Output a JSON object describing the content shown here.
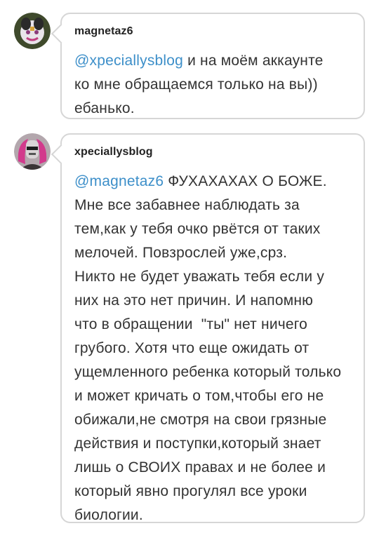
{
  "comments": [
    {
      "username": "magnetaz6",
      "mention": "@xpeciallysblog",
      "first_line_rest": " и на моём аккаунте",
      "lines": [
        "ко мне обращаемся только на вы))",
        "ебанько."
      ]
    },
    {
      "username": "xpeciallysblog",
      "mention": "@magnetaz6",
      "first_line_rest": " ФУХАХАХАХ О БОЖЕ.",
      "lines": [
        "Мне все забавнее наблюдать за",
        "тем,как у тебя очко рвётся от таких",
        "мелочей. Повзрослей уже,срз.",
        "Никто не будет уважать тебя если у",
        "них на это нет причин. И напомню",
        "что в обращении  \"ты\" нет ничего",
        "грубого. Хотя что еще ожидать от",
        "ущемленного ребенка который только",
        "и может кричать о том,чтобы его не",
        "обижали,не смотря на свои грязные",
        "действия и поступки,который знает",
        "лишь о СВОИХ правах и не более и",
        "который явно прогулял все уроки",
        "биологии."
      ]
    }
  ],
  "colors": {
    "mention": "#3d8fc9",
    "border": "#d6d6d6",
    "text": "#333333"
  }
}
